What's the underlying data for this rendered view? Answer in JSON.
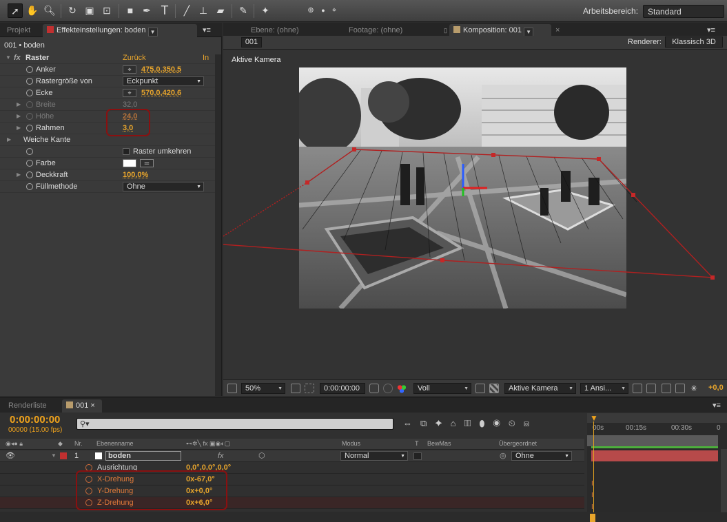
{
  "toolbar": {
    "tools": [
      "selection-tool",
      "hand-tool",
      "zoom-tool",
      "rotate-tool",
      "camera-tool",
      "pan-behind-tool",
      "rectangle-tool",
      "pen-tool",
      "text-tool",
      "brush-tool",
      "clone-stamp-tool",
      "eraser-tool",
      "roto-brush-tool",
      "puppet-tool"
    ],
    "workspace_label": "Arbeitsbereich:",
    "workspace_value": "Standard"
  },
  "left_panel": {
    "tab_project": "Projekt",
    "tab_effects": "Effekteinstellungen: boden",
    "title": "001 • boden",
    "effect_name": "Raster",
    "reset_label": "Zurück",
    "about_label": "In",
    "rows": [
      {
        "name": "Anker",
        "value": "475,0,350,5"
      },
      {
        "name": "Rastergröße von",
        "value": "Eckpunkt"
      },
      {
        "name": "Ecke",
        "value": "570,0,420,6"
      },
      {
        "name": "Breite",
        "value": "32,0"
      },
      {
        "name": "Höhe",
        "value": "24,0"
      },
      {
        "name": "Rahmen",
        "value": "3,0"
      },
      {
        "name": "Weiche Kante",
        "value": ""
      },
      {
        "name": "",
        "value": "Raster umkehren"
      },
      {
        "name": "Farbe",
        "value": ""
      },
      {
        "name": "Deckkraft",
        "value": "100,0%"
      },
      {
        "name": "Füllmethode",
        "value": "Ohne"
      }
    ]
  },
  "comp_panel": {
    "tab_layer": "Ebene: (ohne)",
    "tab_footage": "Footage: (ohne)",
    "tab_comp": "Komposition: 001",
    "comp_badge": "001",
    "renderer_label": "Renderer:",
    "renderer_value": "Klassisch 3D",
    "camera_label": "Aktive Kamera",
    "zoom": "50%",
    "timecode": "0:00:00:00",
    "resolution": "Voll",
    "view": "Aktive Kamera",
    "views": "1 Ansi...",
    "offset": "+0,0"
  },
  "timeline": {
    "tab_render": "Renderliste",
    "tab_comp": "001",
    "timecode": "0:00:00:00",
    "fps": "00000 (15.00 fps)",
    "col_nr": "Nr.",
    "col_name": "Ebenenname",
    "col_mode": "Modus",
    "col_t": "T",
    "col_trkmat": "BewMas",
    "col_parent": "Übergeordnet",
    "layer_number": "1",
    "layer_name": "boden",
    "layer_mode": "Normal",
    "layer_parent": "Ohne",
    "props": [
      {
        "name": "Ausrichtung",
        "value": "0,0°,0,0°,0,0°"
      },
      {
        "name": "X-Drehung",
        "value": "0x-67,0°"
      },
      {
        "name": "Y-Drehung",
        "value": "0x+0,0°"
      },
      {
        "name": "Z-Drehung",
        "value": "0x+6,0°"
      }
    ],
    "ruler_marks": [
      "00s",
      "00:15s",
      "00:30s",
      "0"
    ]
  },
  "colors": {
    "accent_orange": "#e8a52c",
    "highlight_red": "#8a1010",
    "layer_label": "#c23030"
  }
}
